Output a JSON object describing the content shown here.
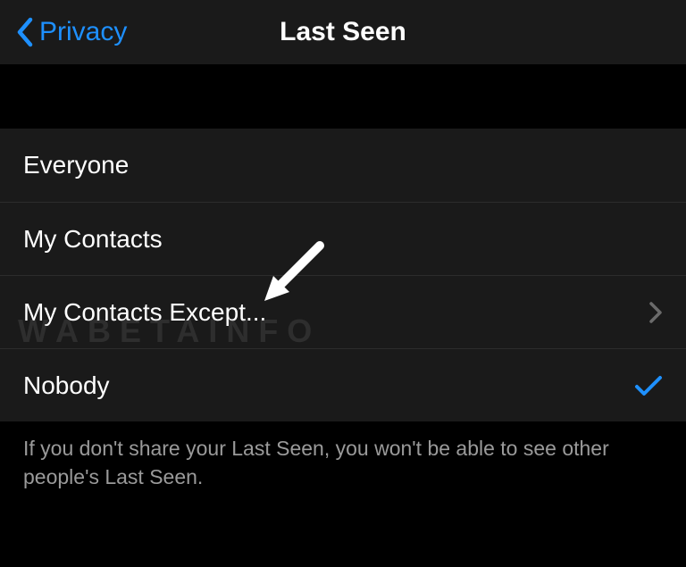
{
  "nav": {
    "back_label": "Privacy",
    "title": "Last Seen"
  },
  "options": [
    {
      "label": "Everyone",
      "disclosure": false,
      "selected": false
    },
    {
      "label": "My Contacts",
      "disclosure": false,
      "selected": false
    },
    {
      "label": "My Contacts Except...",
      "disclosure": true,
      "selected": false
    },
    {
      "label": "Nobody",
      "disclosure": false,
      "selected": true
    }
  ],
  "footer": "If you don't share your Last Seen, you won't be able to see other people's Last Seen.",
  "watermark": "WABETAINFO"
}
